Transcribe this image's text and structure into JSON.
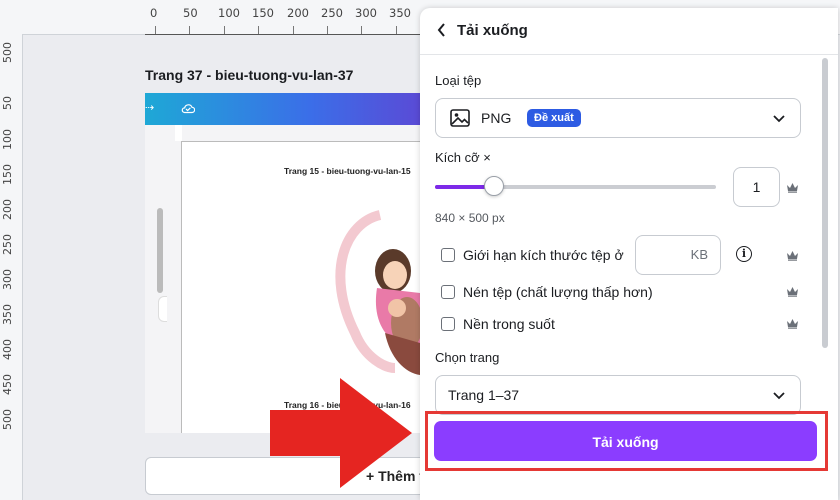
{
  "ruler": {
    "top_ticks": [
      "0",
      "50",
      "100",
      "150",
      "200",
      "250",
      "300",
      "350"
    ],
    "left_ticks": [
      "500",
      "50",
      "100",
      "150",
      "200",
      "250",
      "300",
      "350",
      "400",
      "450",
      "500"
    ]
  },
  "canvas": {
    "page_title": "Trang 37 - bieu-tuong-vu-lan-37",
    "inner_page_15": "Trang 15 - bieu-tuong-vu-lan-15",
    "inner_page_16": "Trang 16 - bieu-tuong-vu-lan-16",
    "add_page_label": "+ Thêm trang"
  },
  "panel": {
    "title": "Tải xuống",
    "file_type_label": "Loại tệp",
    "file_type_value": "PNG",
    "file_type_badge": "Đề xuất",
    "size_label": "Kích cỡ ×",
    "size_value": "1",
    "size_slider_fraction": 0.21,
    "dimensions": "840 × 500 px",
    "options": [
      {
        "label": "Giới hạn kích thước tệp ở",
        "checked": false
      },
      {
        "label": "Nén tệp (chất lượng thấp hơn)",
        "checked": false
      },
      {
        "label": "Nền trong suốt",
        "checked": false
      }
    ],
    "kb_unit": "KB",
    "pages_label": "Chọn trang",
    "pages_value": "Trang 1–37",
    "download_button": "Tải xuống"
  },
  "colors": {
    "accent": "#8b3dff",
    "badge": "#2d5be3",
    "highlight": "#e53935",
    "arrow": "#e52521"
  },
  "icons": [
    "chevron-left-icon",
    "image-icon",
    "chevron-down-icon",
    "crown-icon",
    "info-icon",
    "arrow-right-icon"
  ]
}
